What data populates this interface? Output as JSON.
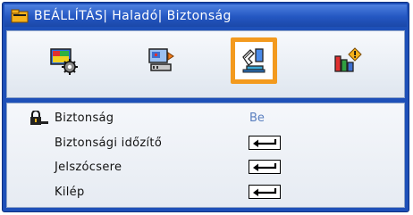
{
  "title": "BEÁLLÍTÁS| Haladó| Biztonság",
  "tabs": [
    {
      "icon": "picture-settings-icon",
      "selected": false
    },
    {
      "icon": "display-settings-icon",
      "selected": false
    },
    {
      "icon": "setup-settings-icon",
      "selected": true
    },
    {
      "icon": "options-settings-icon",
      "selected": false
    }
  ],
  "rows": [
    {
      "label": "Biztonság",
      "value": "Be",
      "icon": "lock-icon"
    },
    {
      "label": "Biztonsági időzítő",
      "control": "enter-icon"
    },
    {
      "label": "Jelszócsere",
      "control": "enter-icon"
    },
    {
      "label": "Kilép",
      "control": "enter-icon"
    }
  ],
  "colors": {
    "frame": "#1e50b8",
    "titlebar": "#2457c2",
    "selection": "#f39a1e",
    "value_text": "#5a7fbf"
  }
}
